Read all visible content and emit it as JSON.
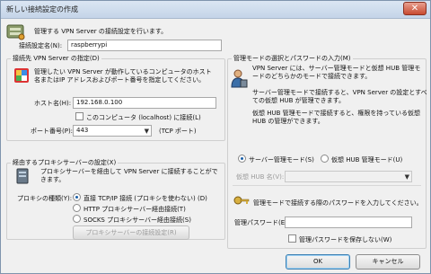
{
  "window": {
    "title": "新しい接続設定の作成",
    "close_glyph": "✕"
  },
  "header": {
    "description": "管理する VPN Server の接続設定を行います。"
  },
  "connection": {
    "name_label": "接続設定名(N):",
    "name_value": "raspberrypi"
  },
  "dest_group": {
    "title": "接続先 VPN Server の指定(D)",
    "description_line1": "管理したい VPN Server が動作しているコンピュータのホスト",
    "description_line2": "名またはIP アドレスおよびポート番号を指定してください。",
    "host_label": "ホスト名(H):",
    "host_value": "192.168.0.100",
    "localhost_label": "このコンピュータ (localhost) に接続(L)",
    "port_label": "ポート番号(P):",
    "port_value": "443",
    "port_suffix": "(TCP ポート)"
  },
  "proxy_group": {
    "title": "経由するプロキシサーバーの設定(X)",
    "description_line1": "プロキシサーバーを経由して VPN Server に接続することがで",
    "description_line2": "きます。",
    "type_label": "プロキシの種類(Y):",
    "options": [
      "直接 TCP/IP 接続 (プロキシを使わない) (D)",
      "HTTP プロキシサーバー経由接続(T)",
      "SOCKS プロキシサーバー経由接続(S)"
    ],
    "settings_button": "プロキシサーバーの接続設定(R)"
  },
  "mode_group": {
    "title": "管理モードの選択とパスワードの入力(M)",
    "para1_line1": "VPN Server には、サーバー管理モードと仮想 HUB 管理モ",
    "para1_line2": "ードのどちらかのモードで接続できます。",
    "para2_line1": "サーバー管理モードで接続すると、VPN Server の設定とすべ",
    "para2_line2": "ての仮想 HUB が管理できます。",
    "para3_line1": "仮想 HUB 管理モードで接続すると、権限を持っている仮想",
    "para3_line2": "HUB の管理ができます。",
    "server_mode_label": "サーバー管理モード(S)",
    "hub_mode_label": "仮想 HUB 管理モード(U)",
    "hub_name_label": "仮想 HUB 名(V):",
    "password_prompt": "管理モードで接続する際のパスワードを入力してください。",
    "password_label": "管理パスワード(E):",
    "password_value": "",
    "save_password_label": "管理パスワードを保存しない(W)"
  },
  "footer": {
    "ok": "OK",
    "cancel": "キャンセル"
  }
}
